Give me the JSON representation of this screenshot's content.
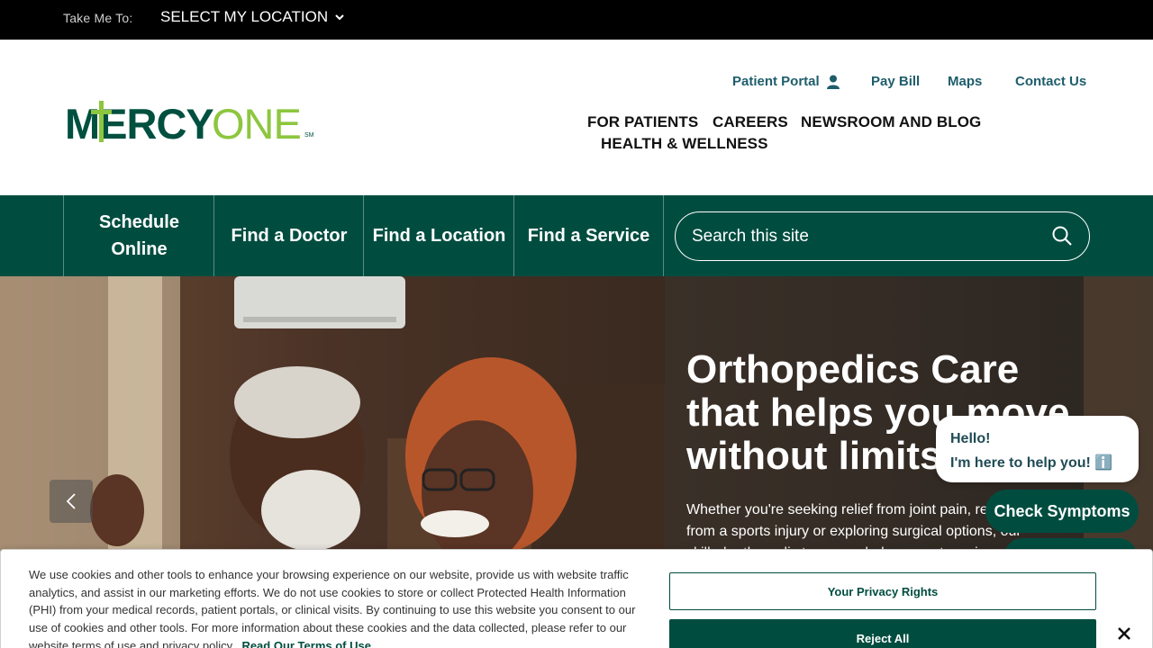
{
  "topbar": {
    "take_me_to": "Take Me To:",
    "location_select": "SELECT MY LOCATION"
  },
  "brand": {
    "name_part1": "MERCY",
    "name_part2": "ONE",
    "trademark": "SM",
    "dark_green": "#00503f",
    "light_green": "#8dc63f"
  },
  "utility_nav": {
    "patient_portal": "Patient Portal",
    "pay_bill": "Pay Bill",
    "maps": "Maps",
    "contact_us": "Contact Us"
  },
  "main_nav": {
    "for_patients": "FOR PATIENTS",
    "careers": "CAREERS",
    "newsroom": "NEWSROOM AND BLOG",
    "health_wellness": "HEALTH & WELLNESS"
  },
  "action_bar": {
    "schedule_line1": "Schedule",
    "schedule_line2": "Online",
    "find_doctor": "Find a Doctor",
    "find_location": "Find a Location",
    "find_service": "Find a Service",
    "search_placeholder": "Search this site"
  },
  "hero": {
    "title": "Orthopedics Care that helps you move without limits.",
    "body": "Whether you're seeking relief from joint pain, recovering from a sports injury or exploring surgical options, our skilled orthopedic team can help you get moving with less pain."
  },
  "chat": {
    "greeting": "Hello!",
    "message": "I'm here to help you! ℹ️",
    "check_symptoms": "Check Symptoms"
  },
  "cookie": {
    "text": "We use cookies and other tools to enhance your browsing experience on our website, provide us with website traffic analytics, and assist in our marketing efforts. We do not use cookies to store or collect Protected Health Information (PHI) from your medical records, patient portals, or clinical visits. By continuing to use this website you consent to our use of cookies and other tools. For more information about these cookies and the data collected, please refer to our website terms of use and privacy policy.",
    "terms_link": "Read Our Terms of Use",
    "privacy_rights": "Your Privacy Rights",
    "reject_all": "Reject All"
  },
  "colors": {
    "primary": "#004d40",
    "link": "#1f5d6b",
    "topbar": "#000000"
  }
}
